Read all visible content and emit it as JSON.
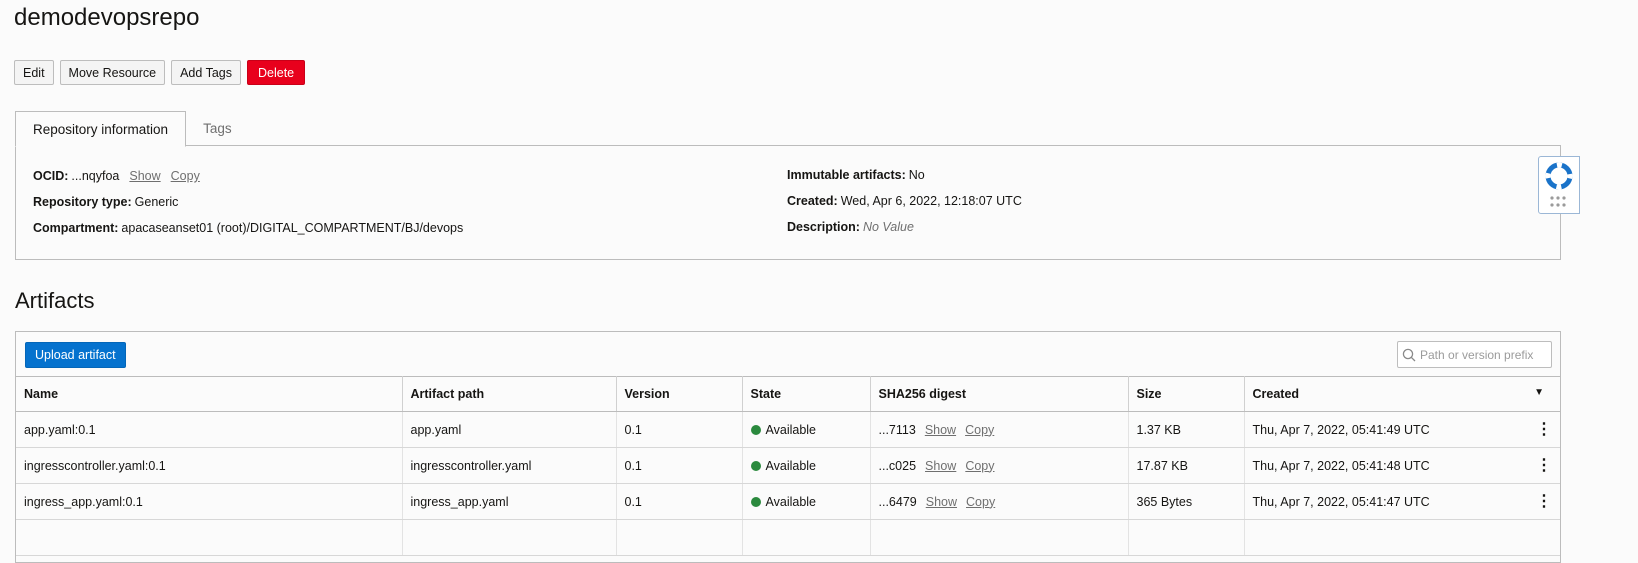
{
  "page": {
    "title": "demodevopsrepo"
  },
  "actions": {
    "edit": "Edit",
    "move": "Move Resource",
    "add_tags": "Add Tags",
    "delete": "Delete"
  },
  "tabs": [
    {
      "label": "Repository information",
      "active": true
    },
    {
      "label": "Tags",
      "active": false
    }
  ],
  "info": {
    "ocid_label": "OCID:",
    "ocid_value": "...nqyfoa",
    "show": "Show",
    "copy": "Copy",
    "type_label": "Repository type:",
    "type_value": "Generic",
    "compartment_label": "Compartment:",
    "compartment_value": "apacaseanset01 (root)/DIGITAL_COMPARTMENT/BJ/devops",
    "immutable_label": "Immutable artifacts:",
    "immutable_value": "No",
    "created_label": "Created:",
    "created_value": "Wed, Apr 6, 2022, 12:18:07 UTC",
    "description_label": "Description:",
    "description_value": "No Value"
  },
  "artifacts": {
    "heading": "Artifacts",
    "upload_label": "Upload artifact",
    "search_placeholder": "Path or version prefix",
    "columns": [
      "Name",
      "Artifact path",
      "Version",
      "State",
      "SHA256 digest",
      "Size",
      "Created"
    ],
    "rows": [
      {
        "name": "app.yaml:0.1",
        "path": "app.yaml",
        "version": "0.1",
        "state": "Available",
        "digest": "...7113",
        "show": "Show",
        "copy": "Copy",
        "size": "1.37 KB",
        "created": "Thu, Apr 7, 2022, 05:41:49 UTC"
      },
      {
        "name": "ingresscontroller.yaml:0.1",
        "path": "ingresscontroller.yaml",
        "version": "0.1",
        "state": "Available",
        "digest": "...c025",
        "show": "Show",
        "copy": "Copy",
        "size": "17.87 KB",
        "created": "Thu, Apr 7, 2022, 05:41:48 UTC"
      },
      {
        "name": "ingress_app.yaml:0.1",
        "path": "ingress_app.yaml",
        "version": "0.1",
        "state": "Available",
        "digest": "...6479",
        "show": "Show",
        "copy": "Copy",
        "size": "365 Bytes",
        "created": "Thu, Apr 7, 2022, 05:41:47 UTC"
      }
    ]
  },
  "colors": {
    "danger": "#e8001c",
    "primary": "#0572ce",
    "available": "#2b8a3e",
    "help": "#1a73c9"
  },
  "icons": {
    "search": "search-icon",
    "kebab": "kebab-menu-icon",
    "help": "help-lifebuoy-icon",
    "sort": "caret-down-icon"
  }
}
